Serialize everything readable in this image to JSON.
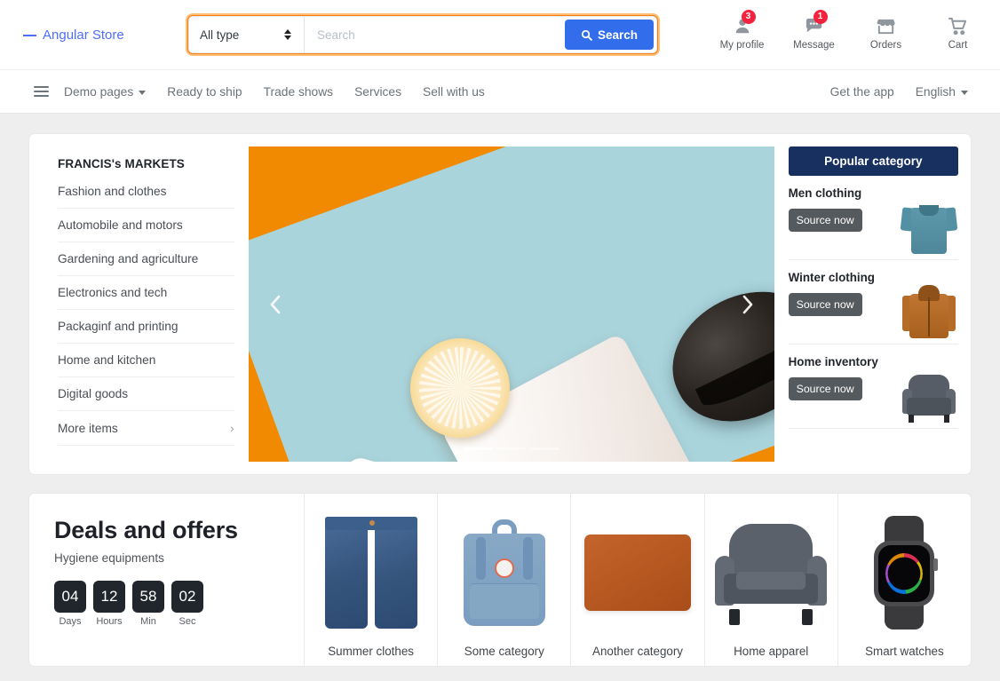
{
  "header": {
    "logo_text": "Angular Store",
    "search": {
      "type_label": "All type",
      "placeholder": "Search",
      "value": "",
      "button_label": "Search"
    },
    "actions": [
      {
        "label": "My profile",
        "icon": "user-icon",
        "badge": "3"
      },
      {
        "label": "Message",
        "icon": "chat-icon",
        "badge": "1"
      },
      {
        "label": "Orders",
        "icon": "store-icon",
        "badge": ""
      },
      {
        "label": "Cart",
        "icon": "cart-icon",
        "badge": ""
      }
    ]
  },
  "nav": {
    "items": [
      {
        "label": "Demo pages",
        "has_caret": true
      },
      {
        "label": "Ready to ship",
        "has_caret": false
      },
      {
        "label": "Trade shows",
        "has_caret": false
      },
      {
        "label": "Services",
        "has_caret": false
      },
      {
        "label": "Sell with us",
        "has_caret": false
      }
    ],
    "right": [
      {
        "label": "Get the app",
        "has_caret": false
      },
      {
        "label": "English",
        "has_caret": true
      }
    ]
  },
  "sidebar": {
    "title": "FRANCIS's MARKETS",
    "items": [
      {
        "label": "Fashion and clothes",
        "chevron": ""
      },
      {
        "label": "Automobile and motors",
        "chevron": ""
      },
      {
        "label": "Gardening and agriculture",
        "chevron": ""
      },
      {
        "label": "Electronics and tech",
        "chevron": ""
      },
      {
        "label": "Packaginf and printing",
        "chevron": ""
      },
      {
        "label": "Home and kitchen",
        "chevron": ""
      },
      {
        "label": "Digital goods",
        "chevron": ""
      },
      {
        "label": "More items",
        "chevron": "›"
      }
    ]
  },
  "carousel": {
    "prev_icon": "chevron-left-icon",
    "next_icon": "chevron-right-icon",
    "slide_count": 3,
    "active_slide": 1
  },
  "popular": {
    "title": "Popular category",
    "items": [
      {
        "title": "Men clothing",
        "button": "Source now",
        "thumb": "polo-shirt"
      },
      {
        "title": "Winter clothing",
        "button": "Source now",
        "thumb": "winter-jacket"
      },
      {
        "title": "Home inventory",
        "button": "Source now",
        "thumb": "armchair"
      }
    ]
  },
  "deals": {
    "title": "Deals and offers",
    "subtitle": "Hygiene equipments",
    "timer": [
      {
        "value": "04",
        "label": "Days"
      },
      {
        "value": "12",
        "label": "Hours"
      },
      {
        "value": "58",
        "label": "Min"
      },
      {
        "value": "02",
        "label": "Sec"
      }
    ],
    "items": [
      {
        "name": "Summer clothes",
        "art": "denim-shorts"
      },
      {
        "name": "Some category",
        "art": "backpack"
      },
      {
        "name": "Another category",
        "art": "tablet-case"
      },
      {
        "name": "Home apparel",
        "art": "armchair"
      },
      {
        "name": "Smart watches",
        "art": "smart-watch"
      }
    ]
  },
  "colors": {
    "brand_blue": "#4f6ef7",
    "search_button": "#326dec",
    "focus_ring": "#f28017",
    "badge_red": "#f4223c",
    "popular_header": "#17305f",
    "timer_box": "#20262c"
  }
}
